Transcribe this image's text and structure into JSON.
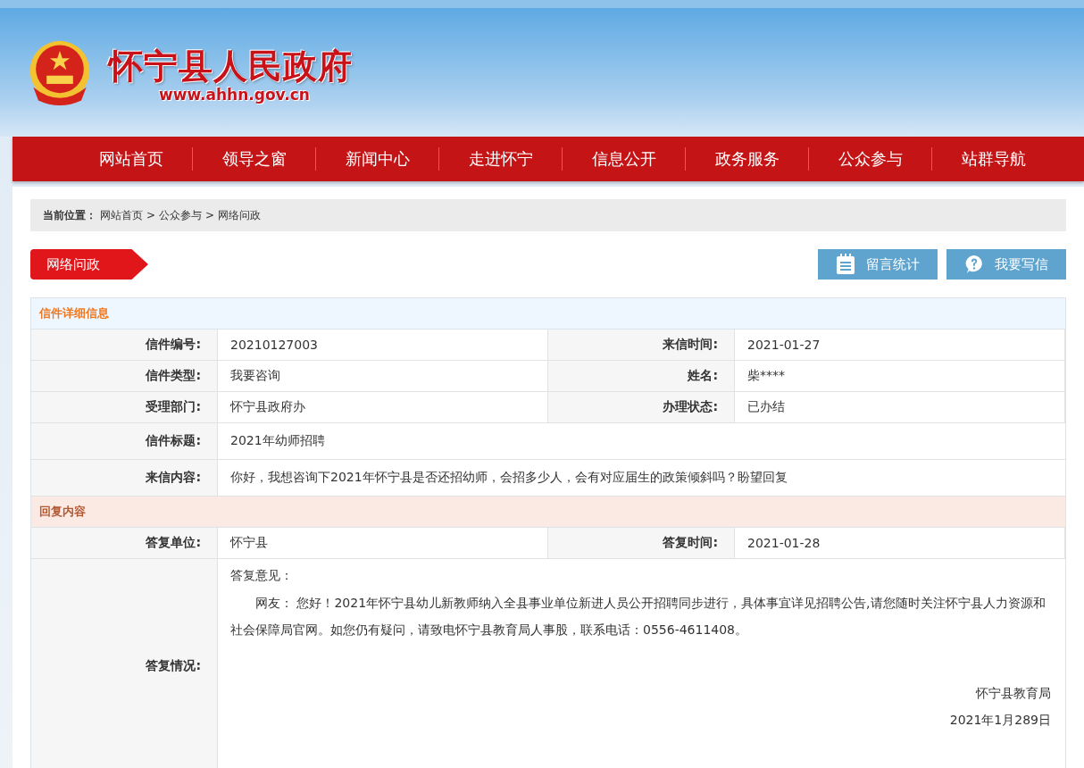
{
  "header": {
    "title": "怀宁县人民政府",
    "url": "www.ahhn.gov.cn"
  },
  "nav": [
    {
      "label": "网站首页"
    },
    {
      "label": "领导之窗"
    },
    {
      "label": "新闻中心"
    },
    {
      "label": "走进怀宁"
    },
    {
      "label": "信息公开"
    },
    {
      "label": "政务服务"
    },
    {
      "label": "公众参与"
    },
    {
      "label": "站群导航"
    }
  ],
  "breadcrumb": {
    "label": "当前位置：",
    "separator": ">",
    "items": [
      "网站首页",
      "公众参与",
      "网络问政"
    ]
  },
  "section_tag": "网络问政",
  "buttons": [
    {
      "label": "留言统计",
      "kind": "stats"
    },
    {
      "label": "我要写信",
      "kind": "help"
    }
  ],
  "letter": {
    "title": "信件详细信息",
    "rows": [
      [
        {
          "label": "信件编号:",
          "value": "20210127003"
        },
        {
          "label": "来信时间:",
          "value": "2021-01-27"
        }
      ],
      [
        {
          "label": "信件类型:",
          "value": "我要咨询"
        },
        {
          "label": "姓名:",
          "value": "柴****"
        }
      ],
      [
        {
          "label": "受理部门:",
          "value": "怀宁县政府办"
        },
        {
          "label": "办理状态:",
          "value": "已办结"
        }
      ],
      [
        {
          "label": "信件标题:",
          "value": "2021年幼师招聘"
        }
      ],
      [
        {
          "label": "来信内容:",
          "value": "你好，我想咨询下2021年怀宁县是否还招幼师，会招多少人，会有对应届生的政策倾斜吗？盼望回复"
        }
      ]
    ]
  },
  "reply": {
    "title": "回复内容",
    "rows": [
      [
        {
          "label": "答复单位:",
          "value": "怀宁县"
        },
        {
          "label": "答复时间:",
          "value": "2021-01-28"
        }
      ]
    ],
    "detail": {
      "label": "答复情况:",
      "heading": "答复意见：",
      "body": "网友： 您好！2021年怀宁县幼儿新教师纳入全县事业单位新进人员公开招聘同步进行，具体事宜详见招聘公告,请您随时关注怀宁县人力资源和社会保障局官网。如您仍有疑问，请致电怀宁县教育局人事股，联系电话：0556-4611408。",
      "signature": "怀宁县教育局",
      "date": "2021年1月289日"
    }
  }
}
